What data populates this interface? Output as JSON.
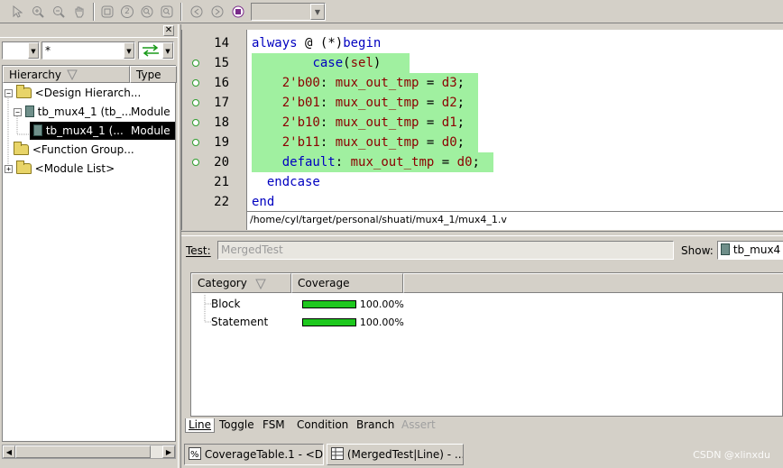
{
  "toolbar": {
    "icons": [
      "select-arrow-icon",
      "zoom-in-icon",
      "zoom-out-icon",
      "pan-hand-icon",
      "fit-icon",
      "two-icon",
      "zoom-area-icon",
      "zoom-full-icon",
      "back-icon",
      "forward-icon",
      "mark-icon"
    ],
    "combo_value": ""
  },
  "left_panel": {
    "filter_value": "*",
    "columns": [
      "Hierarchy",
      "Type"
    ],
    "tree": [
      {
        "label": "<Design Hierarch...",
        "type": "",
        "icon": "folder-icon",
        "expander": "−",
        "indent": 0
      },
      {
        "label": "tb_mux4_1 (tb_...",
        "type": "Module",
        "icon": "module-icon",
        "expander": "−",
        "indent": 1
      },
      {
        "label": "tb_mux4_1 (...",
        "type": "Module",
        "icon": "module-icon",
        "expander": "",
        "indent": 2,
        "selected": true
      },
      {
        "label": "<Function Group...",
        "type": "",
        "icon": "folder-icon",
        "expander": "",
        "indent": 0
      },
      {
        "label": "<Module List>",
        "type": "",
        "icon": "folder-icon",
        "expander": "+",
        "indent": 0
      }
    ]
  },
  "source": {
    "lines": [
      {
        "num": "14",
        "text": "always @ (*)begin",
        "covered": false,
        "dot": false
      },
      {
        "num": "15",
        "text": "        case(sel)",
        "covered": true,
        "dot": true
      },
      {
        "num": "16",
        "text": "    2'b00: mux_out_tmp = d3;",
        "covered": true,
        "dot": true
      },
      {
        "num": "17",
        "text": "    2'b01: mux_out_tmp = d2;",
        "covered": true,
        "dot": true
      },
      {
        "num": "18",
        "text": "    2'b10: mux_out_tmp = d1;",
        "covered": true,
        "dot": true
      },
      {
        "num": "19",
        "text": "    2'b11: mux_out_tmp = d0;",
        "covered": true,
        "dot": true
      },
      {
        "num": "20",
        "text": "    default: mux_out_tmp = d0;",
        "covered": true,
        "dot": true
      },
      {
        "num": "21",
        "text": "  endcase",
        "covered": false,
        "dot": false
      },
      {
        "num": "22",
        "text": "end",
        "covered": false,
        "dot": false
      }
    ],
    "path": "/home/cyl/target/personal/shuati/mux4_1/mux4_1.v"
  },
  "coverage": {
    "test_label": "Test:",
    "test_value": "MergedTest",
    "show_label": "Show:",
    "show_value": "tb_mux4",
    "columns": [
      "Category",
      "Coverage"
    ],
    "rows": [
      {
        "category": "Block",
        "coverage": "100.00%",
        "fraction": 1.0
      },
      {
        "category": "Statement",
        "coverage": "100.00%",
        "fraction": 1.0
      }
    ],
    "tabs": [
      "Line",
      "Toggle",
      "FSM",
      "Condition",
      "Branch",
      "Assert"
    ]
  },
  "taskbar": {
    "items": [
      "CoverageTable.1 - <D...",
      "(MergedTest|Line) - ..."
    ]
  },
  "watermark": "CSDN @xlinxdu",
  "colors": {
    "covered": "#a0f0a0",
    "bar": "#1ec81e",
    "keyword": "#0000c0",
    "identifier": "#8b0000"
  }
}
